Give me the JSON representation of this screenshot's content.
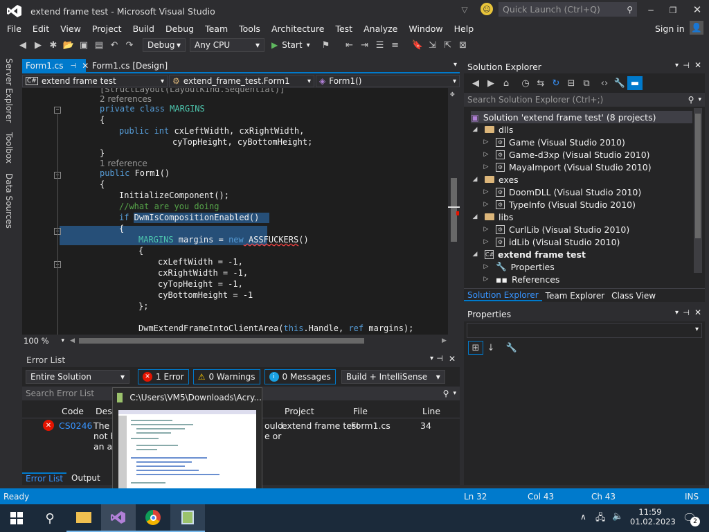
{
  "window": {
    "title": "extend frame test - Microsoft Visual Studio",
    "quick_launch": "Quick Launch (Ctrl+Q)",
    "sign_in": "Sign in"
  },
  "menu": [
    "File",
    "Edit",
    "View",
    "Project",
    "Build",
    "Debug",
    "Team",
    "Tools",
    "Architecture",
    "Test",
    "Analyze",
    "Window",
    "Help"
  ],
  "toolbar": {
    "config": "Debug",
    "platform": "Any CPU",
    "start": "Start"
  },
  "side_tabs": [
    "Server Explorer",
    "Toolbox",
    "Data Sources"
  ],
  "doc_tabs": [
    {
      "label": "Form1.cs",
      "pin": "⊣",
      "active": true
    },
    {
      "label": "Form1.cs [Design]"
    }
  ],
  "nav": {
    "project": "extend frame test",
    "class": "extend_frame_test.Form1",
    "member": "Form1()"
  },
  "code": {
    "l0": "[StructLayout(LayoutKind.Sequential)]",
    "ref1": "2 references",
    "l1_kw": "private class",
    "l1_ty": "MARGINS",
    "l2": "{",
    "l3_kw1": "public int",
    "l3_rest": " cxLeftWidth, cxRightWidth,",
    "l4": "cyTopHeight, cyBottomHeight;",
    "l5": "}",
    "ref2": "1 reference",
    "l6_kw": "public",
    "l6_rest": " Form1()",
    "l7": "{",
    "l8": "InitializeComponent();",
    "l9": "//what are you doing",
    "l10_kw": "if",
    "l10_rest": " DwmIsCompositionEnabled()",
    "l11": "{",
    "l12_ty": "MARGINS",
    "l12_mid": " margins = ",
    "l12_kw": "new",
    "l12_err": " ASSFUCKERS",
    "l12_end": "()",
    "l13": "{",
    "l14": "cxLeftWidth = -1,",
    "l15": "cxRightWidth = -1,",
    "l16": "cyTopHeight = -1,",
    "l17": "cyBottomHeight = -1",
    "l18": "};",
    "l19_a": "DwmExtendFrameIntoClientArea(",
    "l19_kw1": "this",
    "l19_b": ".Handle, ",
    "l19_kw2": "ref",
    "l19_c": " margins);"
  },
  "zoom": "100 %",
  "error_list": {
    "title": "Error List",
    "scope": "Entire Solution",
    "errors": "1 Error",
    "warnings": "0 Warnings",
    "messages": "0 Messages",
    "build": "Build + IntelliSense",
    "search": "Search Error List",
    "columns": {
      "code": "Code",
      "desc": "Desc",
      "project": "Project",
      "file": "File",
      "line": "Line"
    },
    "row": {
      "code": "CS0246",
      "desc1": "The t",
      "desc2": "not b",
      "desc3": "an as",
      "frag1": "ould",
      "frag2": "e or",
      "project": "extend frame test",
      "file": "Form1.cs",
      "line": "34"
    },
    "tabs": [
      "Error List",
      "Output"
    ]
  },
  "thumbnail": {
    "title": "C:\\Users\\VM5\\Downloads\\Acry..."
  },
  "solution_explorer": {
    "title": "Solution Explorer",
    "search": "Search Solution Explorer (Ctrl+;)",
    "solution": "Solution 'extend frame test' (8 projects)",
    "items": [
      {
        "label": "dlls",
        "kind": "folder",
        "indent": 1,
        "open": true
      },
      {
        "label": "Game (Visual Studio 2010)",
        "kind": "proj",
        "indent": 2
      },
      {
        "label": "Game-d3xp (Visual Studio 2010)",
        "kind": "proj",
        "indent": 2
      },
      {
        "label": "MayaImport (Visual Studio 2010)",
        "kind": "proj",
        "indent": 2
      },
      {
        "label": "exes",
        "kind": "folder",
        "indent": 1,
        "open": true
      },
      {
        "label": "DoomDLL (Visual Studio 2010)",
        "kind": "proj",
        "indent": 2
      },
      {
        "label": "TypeInfo (Visual Studio 2010)",
        "kind": "proj",
        "indent": 2
      },
      {
        "label": "libs",
        "kind": "folder",
        "indent": 1,
        "open": true
      },
      {
        "label": "CurlLib (Visual Studio 2010)",
        "kind": "proj",
        "indent": 2
      },
      {
        "label": "idLib (Visual Studio 2010)",
        "kind": "proj",
        "indent": 2
      },
      {
        "label": "extend frame test",
        "kind": "cs",
        "indent": 1,
        "open": true,
        "bold": true
      },
      {
        "label": "Properties",
        "kind": "wrench",
        "indent": 2
      },
      {
        "label": "References",
        "kind": "ref",
        "indent": 2
      }
    ],
    "tabs": [
      "Solution Explorer",
      "Team Explorer",
      "Class View"
    ]
  },
  "properties": {
    "title": "Properties"
  },
  "status": {
    "ready": "Ready",
    "ln": "Ln 32",
    "col": "Col 43",
    "ch": "Ch 43",
    "ins": "INS"
  },
  "taskbar": {
    "time": "11:59",
    "date": "01.02.2023",
    "notif": "2"
  }
}
